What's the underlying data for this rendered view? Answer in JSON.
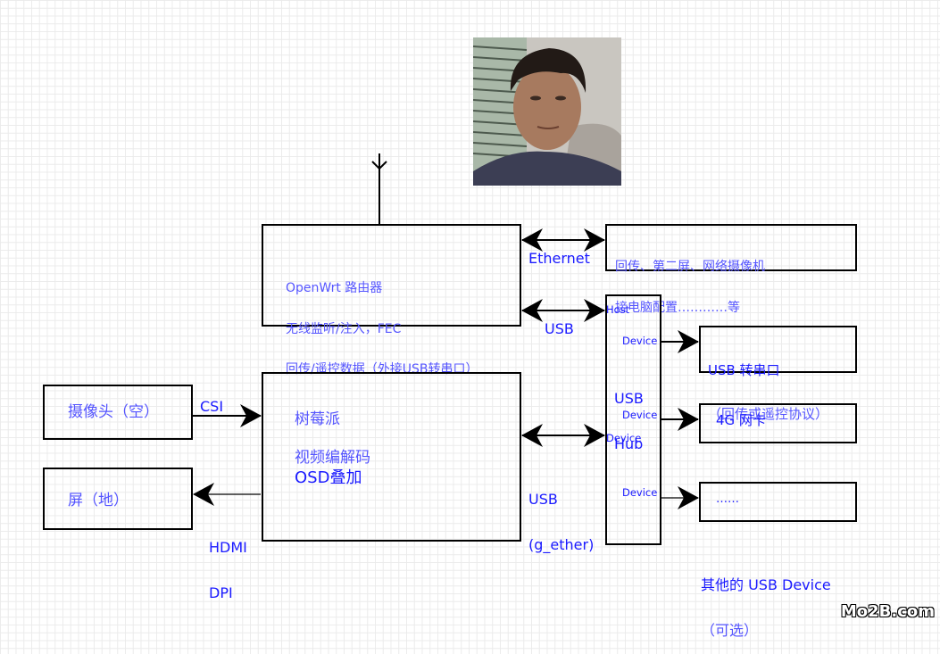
{
  "diagram": {
    "router": {
      "lines": [
        "OpenWrt 路由器",
        "无线监听/注入，FEC",
        "回传/遥控数据（外接USB转串口）"
      ]
    },
    "ethernet_target": {
      "lines": [
        "回传、第二屏、网络摄像机",
        "接电脑配置…………等"
      ]
    },
    "raspberry_pi": {
      "title": "树莓派",
      "lines": [
        "视频编解码",
        "OSD叠加"
      ]
    },
    "camera": {
      "label": "摄像头（空）"
    },
    "screen": {
      "label": "屏（地）"
    },
    "usb_hub": {
      "title_lines": [
        "USB",
        "Hub"
      ],
      "host_port": "Host",
      "upstream_device_port": "Device",
      "downstream_ports": [
        "Device",
        "Device",
        "Device"
      ]
    },
    "usb_serial": {
      "lines": [
        "USB 转串口",
        "（回传或遥控协议）"
      ]
    },
    "modem_4g": {
      "label": "4G 网卡"
    },
    "other_device": {
      "label": "……"
    },
    "other_device_caption": {
      "lines": [
        "其他的 USB Device",
        "（可选）"
      ]
    },
    "links": {
      "ethernet": "Ethernet",
      "usb": "USB",
      "usb_gether": [
        "USB",
        "(g_ether)"
      ],
      "csi": "CSI",
      "hdmi_dpi": [
        "HDMI",
        "DPI"
      ]
    },
    "antenna": {
      "icon": "antenna-icon"
    },
    "photo": {
      "description": "portrait photo of a young man"
    }
  },
  "watermark": "Mo2B.com",
  "colors": {
    "text_blue": "#1a1aff",
    "text_cn": "#5555ff",
    "line": "#000000",
    "grid": "#ebebeb"
  }
}
